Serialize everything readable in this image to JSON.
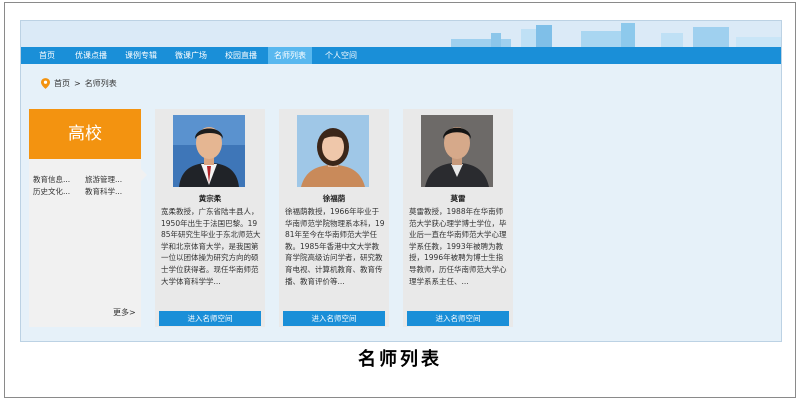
{
  "nav": {
    "items": [
      {
        "label": "首页",
        "active": false
      },
      {
        "label": "优课点播",
        "active": false
      },
      {
        "label": "课例专辑",
        "active": false
      },
      {
        "label": "微课广场",
        "active": false
      },
      {
        "label": "校园直播",
        "active": false
      },
      {
        "label": "名师列表",
        "active": true
      },
      {
        "label": "个人空间",
        "active": false
      }
    ]
  },
  "breadcrumb": {
    "home": "首页",
    "separator": ">",
    "current": "名师列表"
  },
  "sidebar": {
    "title": "高校",
    "categories": [
      "教育信息...",
      "旅游管理...",
      "历史文化...",
      "教育科学..."
    ],
    "more": "更多>"
  },
  "teachers": [
    {
      "name": "黄宗柔",
      "bio": "宽柔教授，广东省陆丰县人，1950年出生于法国巴黎。1985年研究生毕业于东北师范大学和北京体育大学，是我国第一位以团体操为研究方向的硕士学位获得者。现任华南师范大学体育科学学...",
      "button": "进入名师空间"
    },
    {
      "name": "徐福荫",
      "bio": "徐福荫教授，1966年毕业于华南师范学院物理系本科，1981年至今在华南师范大学任教。1985年香港中文大学教育学院高级访问学者，研究教育电视、计算机教育、教育传播、教育评价等...",
      "button": "进入名师空间"
    },
    {
      "name": "莫雷",
      "bio": "莫雷教授，1988年在华南师范大学获心理学博士学位，毕业后一直在华南师范大学心理学系任教，1993年被聘为教授，1996年被聘为博士生指导教师，历任华南师范大学心理学系系主任、...",
      "button": "进入名师空间"
    }
  ],
  "caption": "名师列表",
  "colors": {
    "nav": "#1a8fd8",
    "nav_active": "#59b8ef",
    "sidebar_header": "#f39310",
    "background": "#e6f1f9"
  }
}
